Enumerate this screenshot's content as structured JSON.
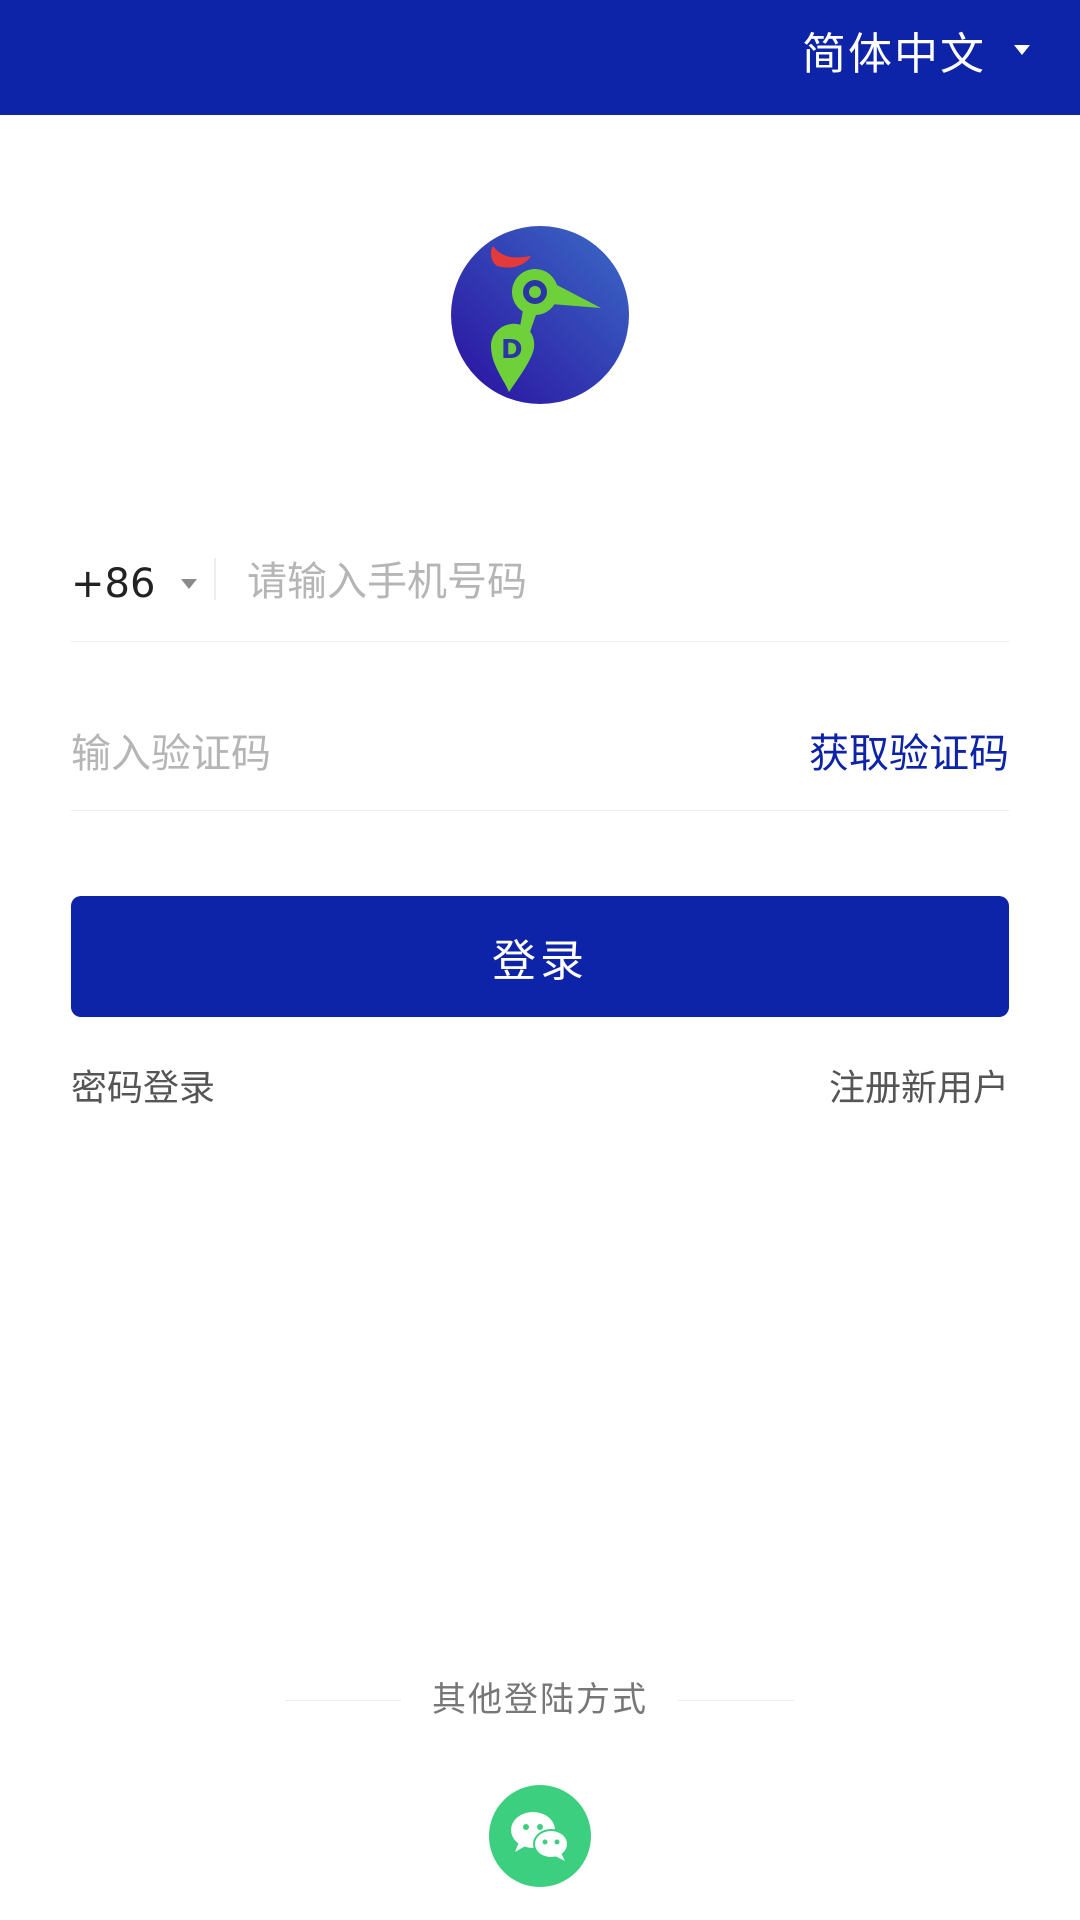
{
  "header": {
    "language_label": "简体中文",
    "language_caret_icon": "caret-down-icon",
    "background_color": "#0d23a8"
  },
  "logo": {
    "icon": "app-logo-bird-icon"
  },
  "login_form": {
    "country_code": "+86",
    "country_caret_icon": "caret-down-icon",
    "phone_placeholder": "请输入手机号码",
    "phone_value": "",
    "code_placeholder": "输入验证码",
    "code_value": "",
    "get_code_label": "获取验证码",
    "login_button_label": "登录",
    "password_login_label": "密码登录",
    "register_label": "注册新用户"
  },
  "other_login": {
    "title": "其他登陆方式",
    "wechat_icon": "wechat-icon",
    "wechat_color": "#3ccf7f"
  },
  "colors": {
    "primary": "#0d23a8",
    "link_text": "#555555",
    "placeholder": "#b5b5b5"
  }
}
